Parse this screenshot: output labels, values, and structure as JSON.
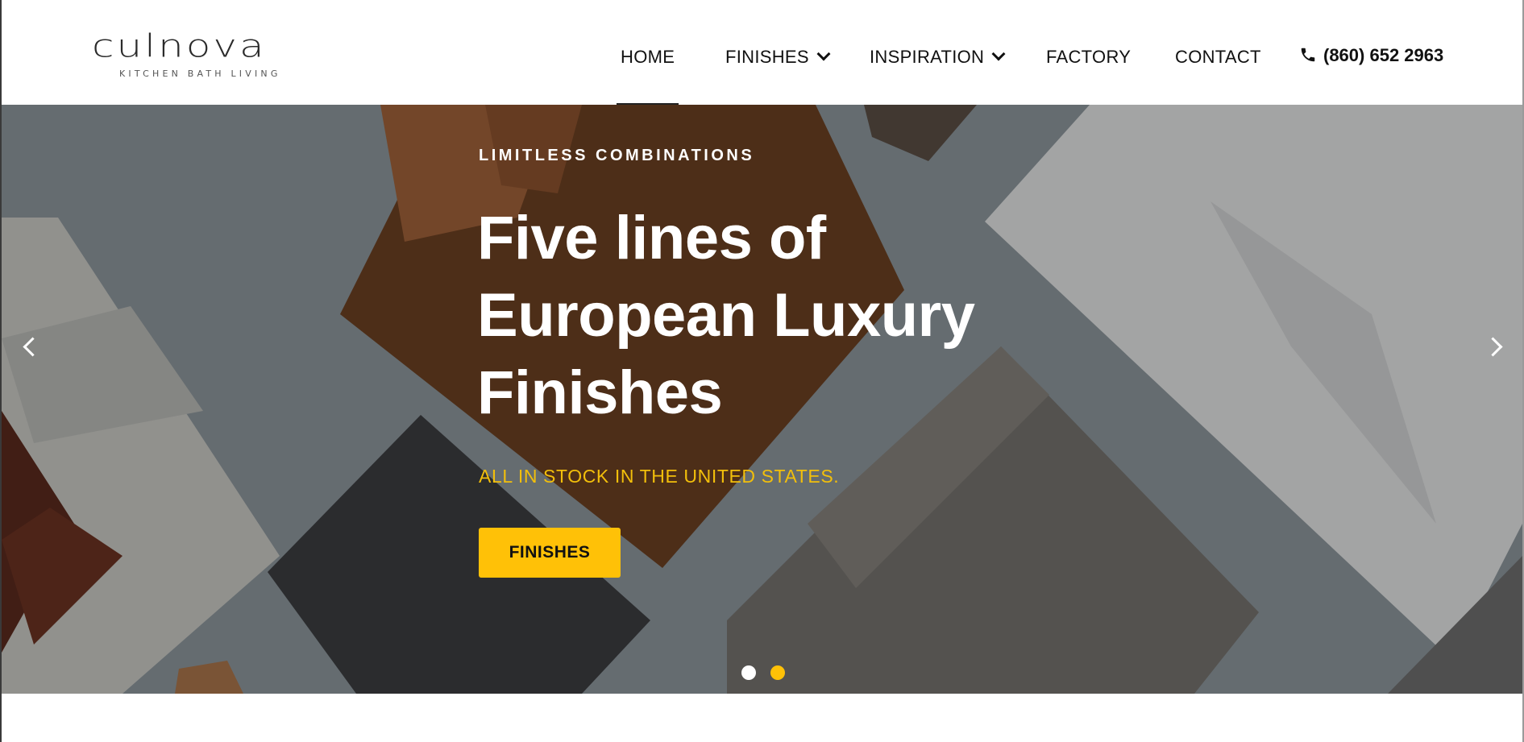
{
  "brand": {
    "logo_word": "culnova",
    "logo_tagline": "KITCHEN BATH LIVING"
  },
  "nav": {
    "items": [
      {
        "label": "HOME",
        "active": true,
        "dropdown": false
      },
      {
        "label": "FINISHES",
        "active": false,
        "dropdown": true
      },
      {
        "label": "INSPIRATION",
        "active": false,
        "dropdown": true
      },
      {
        "label": "FACTORY",
        "active": false,
        "dropdown": false
      },
      {
        "label": "CONTACT",
        "active": false,
        "dropdown": false
      }
    ],
    "phone": "(860) 652 2963",
    "phone_icon": "phone-icon"
  },
  "hero": {
    "eyebrow": "LIMITLESS COMBINATIONS",
    "headline_lines": [
      "Five lines of",
      "European Luxury",
      "Finishes"
    ],
    "subheading": "ALL IN STOCK IN THE UNITED STATES.",
    "cta_label": "FINISHES",
    "prev_icon": "chevron-left-icon",
    "next_icon": "chevron-right-icon",
    "slides_total": 2,
    "active_slide": 2
  },
  "colors": {
    "accent": "#ffc107",
    "subheading": "#f2bf0b",
    "text_dark": "#111111"
  }
}
